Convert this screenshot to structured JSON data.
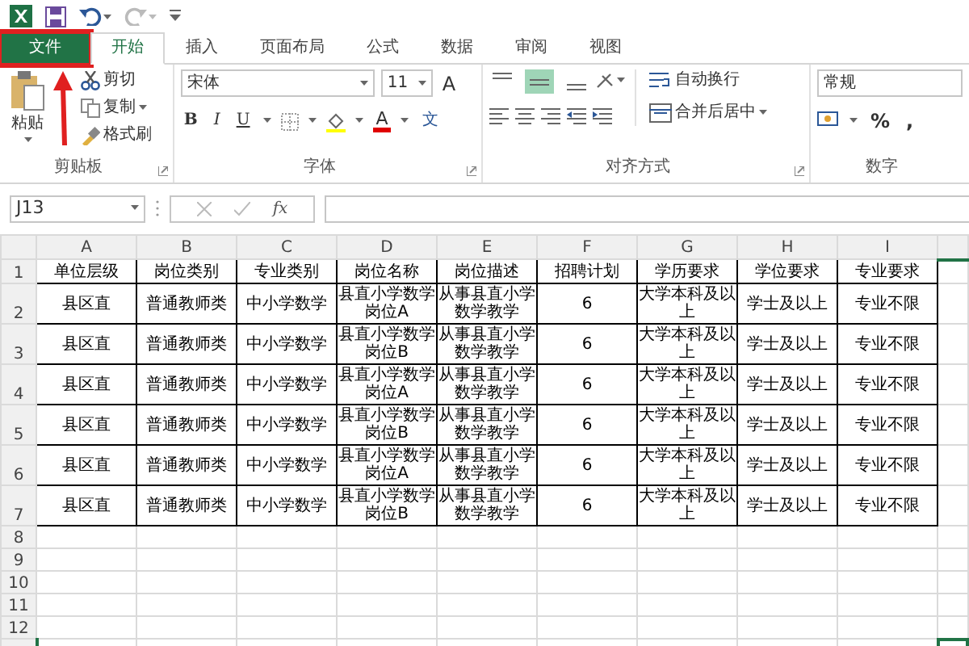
{
  "tabs": [
    {
      "label": "文件",
      "kind": "file",
      "selected": false,
      "highlighted": true
    },
    {
      "label": "开始",
      "kind": "tab",
      "selected": true,
      "highlighted": false
    },
    {
      "label": "插入",
      "kind": "tab",
      "selected": false,
      "highlighted": false
    },
    {
      "label": "页面布局",
      "kind": "tab",
      "selected": false,
      "highlighted": false
    },
    {
      "label": "公式",
      "kind": "tab",
      "selected": false,
      "highlighted": false
    },
    {
      "label": "数据",
      "kind": "tab",
      "selected": false,
      "highlighted": false
    },
    {
      "label": "审阅",
      "kind": "tab",
      "selected": false,
      "highlighted": false
    },
    {
      "label": "视图",
      "kind": "tab",
      "selected": false,
      "highlighted": false
    }
  ],
  "ribbon": {
    "clipboard": {
      "label": "剪贴板",
      "paste": "粘贴",
      "cut": "剪切",
      "copy": "复制",
      "format_painter": "格式刷"
    },
    "font": {
      "label": "字体",
      "font_name": "宋体",
      "font_size": "11",
      "grow": "A",
      "style_buttons": [
        "B",
        "I",
        "U"
      ],
      "font_color": "A",
      "phonetic": "文"
    },
    "alignment": {
      "label": "对齐方式",
      "vertical": [
        {
          "selected": false
        },
        {
          "selected": true
        },
        {
          "selected": false
        }
      ],
      "wrap": "自动换行",
      "merge": "合并后居中"
    },
    "number": {
      "label": "数字",
      "format": "常规",
      "symbols": [
        "%",
        ","
      ]
    }
  },
  "formula_bar": {
    "name_box": "J13",
    "fx": "fx"
  },
  "sheet": {
    "columns": [
      "A",
      "B",
      "C",
      "D",
      "E",
      "F",
      "G",
      "H",
      "I"
    ],
    "rows": [
      {
        "number": "1",
        "cells": [
          "单位层级",
          "岗位类别",
          "专业类别",
          "岗位名称",
          "岗位描述",
          "招聘计划",
          "学历要求",
          "学位要求",
          "专业要求"
        ]
      },
      {
        "number": "2",
        "cells": [
          "县区直",
          "普通教师类",
          "中小学数学",
          "县直小学数学岗位A",
          "从事县直小学数学教学",
          "6",
          "大学本科及以上",
          "学士及以上",
          "专业不限"
        ]
      },
      {
        "number": "3",
        "cells": [
          "县区直",
          "普通教师类",
          "中小学数学",
          "县直小学数学岗位B",
          "从事县直小学数学教学",
          "6",
          "大学本科及以上",
          "学士及以上",
          "专业不限"
        ]
      },
      {
        "number": "4",
        "cells": [
          "县区直",
          "普通教师类",
          "中小学数学",
          "县直小学数学岗位A",
          "从事县直小学数学教学",
          "6",
          "大学本科及以上",
          "学士及以上",
          "专业不限"
        ]
      },
      {
        "number": "5",
        "cells": [
          "县区直",
          "普通教师类",
          "中小学数学",
          "县直小学数学岗位B",
          "从事县直小学数学教学",
          "6",
          "大学本科及以上",
          "学士及以上",
          "专业不限"
        ]
      },
      {
        "number": "6",
        "cells": [
          "县区直",
          "普通教师类",
          "中小学数学",
          "县直小学数学岗位A",
          "从事县直小学数学教学",
          "6",
          "大学本科及以上",
          "学士及以上",
          "专业不限"
        ]
      },
      {
        "number": "7",
        "cells": [
          "县区直",
          "普通教师类",
          "中小学数学",
          "县直小学数学岗位B",
          "从事县直小学数学教学",
          "6",
          "大学本科及以上",
          "学士及以上",
          "专业不限"
        ]
      }
    ],
    "empty_rows": [
      "8",
      "9",
      "10",
      "11",
      "12"
    ]
  }
}
